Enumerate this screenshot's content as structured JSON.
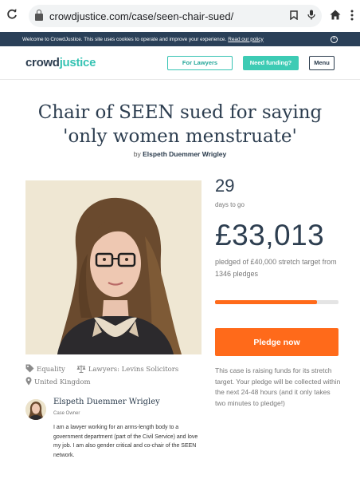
{
  "browser": {
    "url": "crowdjustice.com/case/seen-chair-sued/",
    "icons": [
      "reload-icon",
      "lock-icon",
      "bookmark-icon",
      "mic-icon",
      "home-icon",
      "more-icon"
    ]
  },
  "cookie_banner": {
    "text": "Welcome to CrowdJustice. This site uses cookies to operate and improve your experience.",
    "link": "Read our policy",
    "close": "×"
  },
  "nav": {
    "logo_a": "crowd",
    "logo_b": "justice",
    "for_lawyers": "For Lawyers",
    "need_funding": "Need funding?",
    "menu": "Menu"
  },
  "case": {
    "title": "Chair of SEEN sued for saying 'only women menstruate'",
    "by_prefix": "by",
    "author": "Elspeth Duemmer Wrigley",
    "tags": {
      "category": "Equality",
      "lawyers": "Lawyers: Levins Solicitors",
      "location": "United Kingdom"
    }
  },
  "owner": {
    "name": "Elspeth Duemmer Wrigley",
    "role": "Case Owner",
    "bio": "I am a lawyer working for an arms-length body to a government department (part of the Civil Service) and love my job. I am also gender critical and co-chair of the SEEN network."
  },
  "stats": {
    "days": "29",
    "days_label": "days to go",
    "amount": "£33,013",
    "pledged_text": "pledged of £40,000 stretch target from 1346 pledges",
    "progress": 0.825,
    "pledge_button": "Pledge now",
    "note": "This case is raising funds for its stretch target. Your pledge will be collected within the next 24-48 hours (and it only takes two minutes to pledge!)"
  },
  "colors": {
    "accent": "#36c3b3",
    "pledge": "#ff6a1a",
    "navy": "#2a4058"
  }
}
